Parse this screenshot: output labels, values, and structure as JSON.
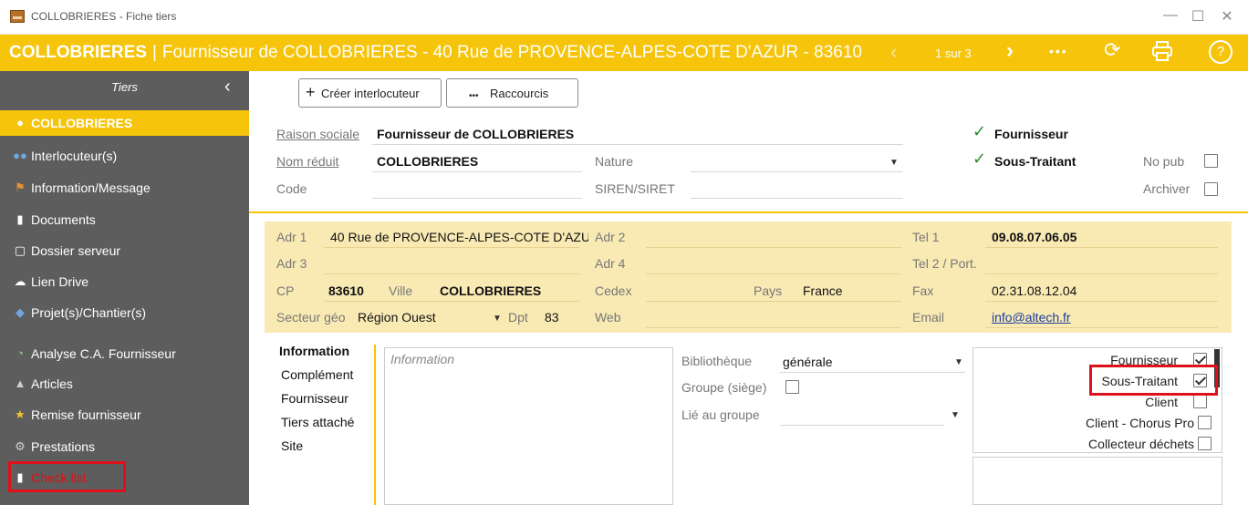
{
  "window": {
    "title": "COLLOBRIERES - Fiche tiers"
  },
  "header": {
    "title_bold": "COLLOBRIERES",
    "separator": "|",
    "subtitle": "Fournisseur de COLLOBRIERES - 40 Rue de PROVENCE-ALPES-COTE D'AZUR - 83610",
    "page_indicator": "1 sur 3",
    "prev": "‹",
    "next": "›",
    "more": "•••"
  },
  "sidebar": {
    "title": "Tiers",
    "items": [
      {
        "label": "COLLOBRIERES",
        "icon": "person-icon"
      },
      {
        "label": "Interlocuteur(s)",
        "icon": "people-icon"
      },
      {
        "label": "Information/Message",
        "icon": "flag-icon"
      },
      {
        "label": "Documents",
        "icon": "document-icon"
      },
      {
        "label": "Dossier serveur",
        "icon": "folder-icon"
      },
      {
        "label": "Lien Drive",
        "icon": "cloud-icon"
      },
      {
        "label": "Projet(s)/Chantier(s)",
        "icon": "project-icon"
      },
      {
        "label": "Analyse C.A. Fournisseur",
        "icon": "pie-chart-icon"
      },
      {
        "label": "Articles",
        "icon": "tag-icon"
      },
      {
        "label": "Remise fournisseur",
        "icon": "discount-icon"
      },
      {
        "label": "Prestations",
        "icon": "gear-icon"
      },
      {
        "label": "Check list",
        "icon": "checklist-icon"
      }
    ]
  },
  "toolbar": {
    "create_contact": "Créer interlocuteur",
    "shortcuts": "Raccourcis",
    "plus": "+",
    "dots": "•••"
  },
  "identity": {
    "raison_sociale_label": "Raison sociale",
    "raison_sociale": "Fournisseur de COLLOBRIERES",
    "nom_reduit_label": "Nom réduit",
    "nom_reduit": "COLLOBRIERES",
    "code_label": "Code",
    "code": "",
    "nature_label": "Nature",
    "nature": "",
    "siren_label": "SIREN/SIRET",
    "siren": "",
    "fournisseur": "Fournisseur",
    "sous_traitant": "Sous-Traitant",
    "no_pub": "No pub",
    "archiver": "Archiver"
  },
  "address": {
    "adr1_label": "Adr 1",
    "adr1": "40 Rue de PROVENCE-ALPES-COTE D'AZU",
    "adr2_label": "Adr 2",
    "adr3_label": "Adr 3",
    "adr4_label": "Adr 4",
    "cp_label": "CP",
    "cp": "83610",
    "ville_label": "Ville",
    "ville": "COLLOBRIERES",
    "cedex_label": "Cedex",
    "pays_label": "Pays",
    "pays": "France",
    "secteur_label": "Secteur géo",
    "secteur": "Région Ouest",
    "dpt_label": "Dpt",
    "dpt": "83",
    "web_label": "Web",
    "tel1_label": "Tel 1",
    "tel1": "09.08.07.06.05",
    "tel2_label": "Tel 2 / Port.",
    "fax_label": "Fax",
    "fax": "02.31.08.12.04",
    "email_label": "Email",
    "email": "info@altech.fr"
  },
  "info_tabs": [
    "Information",
    "Complément",
    "Fournisseur",
    "Tiers attaché",
    "Site"
  ],
  "info": {
    "placeholder": "Information",
    "bibliotheque_label": "Bibliothèque",
    "bibliotheque": "générale",
    "groupe_label": "Groupe (siège)",
    "lie_label": "Lié au groupe"
  },
  "types": [
    {
      "label": "Fournisseur",
      "checked": true
    },
    {
      "label": "Sous-Traitant",
      "checked": true
    },
    {
      "label": "Client",
      "checked": false
    },
    {
      "label": "Client - Chorus Pro",
      "checked": false
    },
    {
      "label": "Collecteur déchets",
      "checked": false
    }
  ],
  "colors": {
    "accent": "#f5c40b",
    "sidebar": "#5d5d5d",
    "highlight": "#e0101a",
    "address_bg": "#f9eab4"
  }
}
